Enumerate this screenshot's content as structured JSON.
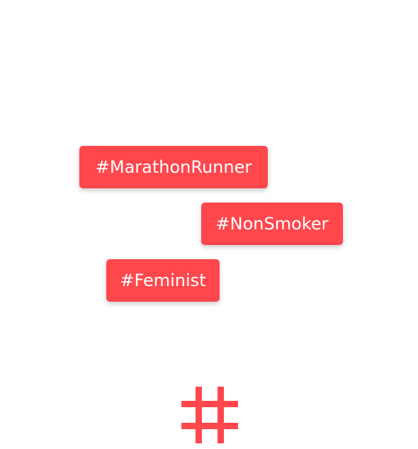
{
  "tags": [
    {
      "label": "#MarathonRunner"
    },
    {
      "label": "#NonSmoker"
    },
    {
      "label": "#Feminist"
    }
  ],
  "icon": {
    "name": "hashtag-icon"
  },
  "colors": {
    "accent": "#ff474c",
    "tag_text": "#ffffff",
    "background": "#ffffff"
  }
}
